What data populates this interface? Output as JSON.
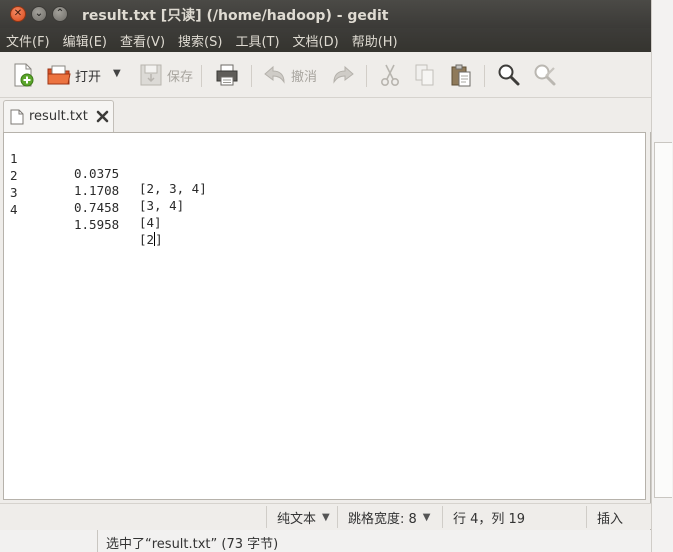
{
  "window": {
    "title": "result.txt [只读] (/home/hadoop) - gedit"
  },
  "menubar": {
    "items": [
      "文件(F)",
      "编辑(E)",
      "查看(V)",
      "搜索(S)",
      "工具(T)",
      "文档(D)",
      "帮助(H)"
    ]
  },
  "toolbar": {
    "open_label": "打开",
    "save_label": "保存",
    "undo_label": "撤消"
  },
  "tabs": [
    {
      "label": "result.txt"
    }
  ],
  "editor": {
    "lines": [
      {
        "num": "1",
        "value": "0.0375",
        "items": "[2, 3, 4]"
      },
      {
        "num": "2",
        "value": "1.1708",
        "items": "[3, 4]"
      },
      {
        "num": "3",
        "value": "0.7458",
        "items": "[4]"
      },
      {
        "num": "4",
        "value": "1.5958",
        "items_before_cursor": "[2",
        "items_after_cursor": "]"
      }
    ]
  },
  "statusbar": {
    "language": "纯文本",
    "tab_width": "跳格宽度: 8",
    "position": "行 4，列 19",
    "mode": "插入"
  },
  "outer_status": {
    "text": "选中了“result.txt” (73 字节)"
  },
  "colors": {
    "titlebar": "#3c3b37",
    "close_button": "#df4a16",
    "editor_bg": "#ffffff"
  }
}
